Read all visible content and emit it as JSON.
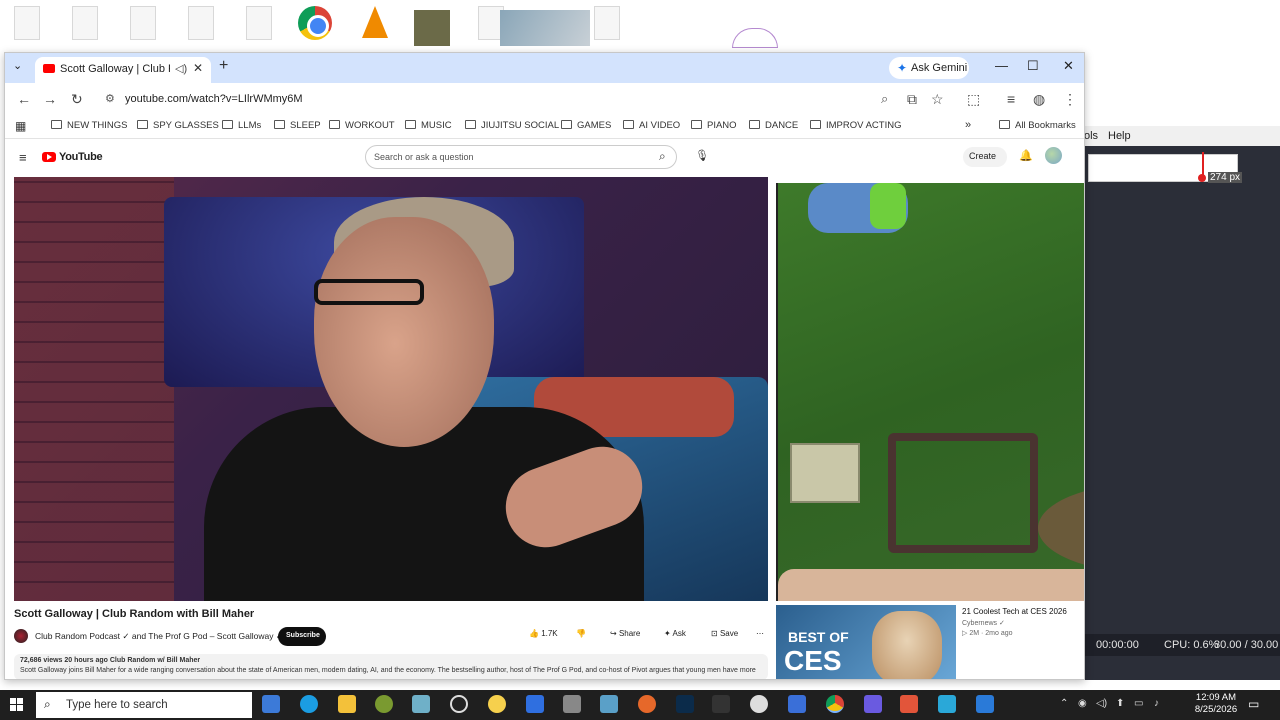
{
  "browser": {
    "tab_title": "Scott Galloway | Club Rand",
    "tab_audio_icon": "speaker-icon",
    "ask_gemini": "Ask Gemini",
    "url": "youtube.com/watch?v=LIlrWMmy6M",
    "bookmarks": [
      "NEW THINGS",
      "SPY GLASSES",
      "LLMs",
      "SLEEP",
      "WORKOUT",
      "MUSIC",
      "JIUJITSU SOCIAL",
      "GAMES",
      "AI VIDEO",
      "PIANO",
      "DANCE",
      "IMPROV ACTING"
    ],
    "all_bookmarks": "All Bookmarks"
  },
  "youtube": {
    "logo_text": "YouTube",
    "search_placeholder": "Search or ask a question",
    "create_label": "Create",
    "video_title": "Scott Galloway | Club Random with Bill Maher",
    "channel": "Club Random Podcast ✓ and The Prof G Pod – Scott Galloway ✓",
    "subscribe": "Subscribe",
    "likes": "1.7K",
    "share": "Share",
    "ask": "Ask",
    "save": "Save",
    "desc_meta": "72,686 views  20 hours ago  Club Random w/ Bill Maher",
    "desc_text": "Scott Galloway joins Bill Maher for a wide ranging conversation about the state of American men, modern dating, AI, and the economy. The bestselling author, host of The Prof G Pod, and co-host of Pivot argues that young men have more",
    "rec": {
      "thumb_line1": "BEST OF",
      "thumb_line2": "CES",
      "title": "21 Coolest Tech at CES 2026",
      "channel": "Cybernews ✓",
      "meta": "▷ 2M · 2mo ago"
    }
  },
  "background_app": {
    "menu": [
      "ols",
      "Help"
    ],
    "px_label": "274 px",
    "time": "00:00:00",
    "cpu": "CPU: 0.6%",
    "fps": "30.00 / 30.00"
  },
  "taskbar": {
    "search_placeholder": "Type here to search",
    "time": "12:09 AM",
    "date": "8/25/2026"
  }
}
